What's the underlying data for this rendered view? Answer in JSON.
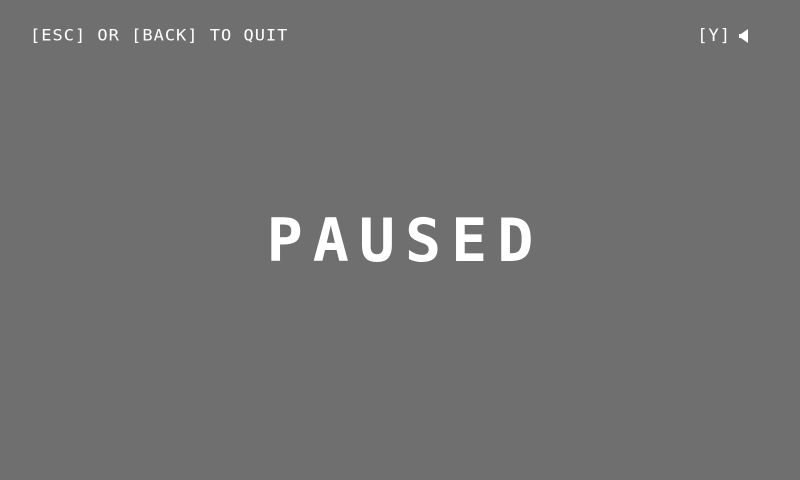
{
  "hud": {
    "quit_hint": "[ESC] OR [BACK] TO QUIT",
    "sound_key": "[Y]",
    "sound_icon": "speaker-muted-icon"
  },
  "overlay": {
    "status": "PAUSED"
  },
  "colors": {
    "background": "#6f6f6f",
    "text": "#ffffff"
  }
}
